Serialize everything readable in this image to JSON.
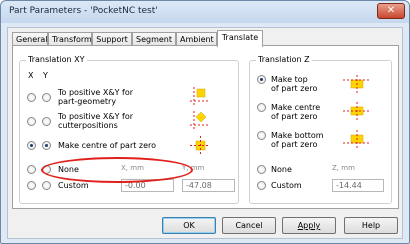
{
  "window": {
    "title": "Part Parameters - 'PocketNC test'",
    "close_glyph": "✕"
  },
  "tabs": [
    {
      "label": "General",
      "active": false
    },
    {
      "label": "Transform",
      "active": false
    },
    {
      "label": "Support",
      "active": false
    },
    {
      "label": "Segment",
      "active": false
    },
    {
      "label": "Ambient",
      "active": false
    },
    {
      "label": "Translate",
      "active": true
    }
  ],
  "translation_xy": {
    "title": "Translation XY",
    "col_x": "X",
    "col_y": "Y",
    "options": [
      {
        "label_line1": "To positive X&Y for",
        "label_line2": "part-geometry",
        "x_checked": false,
        "y_checked": false
      },
      {
        "label_line1": "To positive X&Y for",
        "label_line2": "cutterpositions",
        "x_checked": false,
        "y_checked": false
      },
      {
        "label_line1": "Make centre of part zero",
        "label_line2": "",
        "x_checked": true,
        "y_checked": true
      },
      {
        "label_line1": "None",
        "label_line2": "",
        "x_checked": false,
        "y_checked": false
      },
      {
        "label_line1": "Custom",
        "label_line2": "",
        "x_checked": false,
        "y_checked": false
      }
    ],
    "x_field_label": "X, mm",
    "y_field_label": "Y, mm",
    "x_value": "-0.00",
    "y_value": "-47.08"
  },
  "translation_z": {
    "title": "Translation Z",
    "options": [
      {
        "label_line1": "Make top",
        "label_line2": "of part zero",
        "checked": true
      },
      {
        "label_line1": "Make centre",
        "label_line2": "of part zero",
        "checked": false
      },
      {
        "label_line1": "Make bottom",
        "label_line2": "of part zero",
        "checked": false
      },
      {
        "label_line1": "None",
        "label_line2": "",
        "checked": false
      },
      {
        "label_line1": "Custom",
        "label_line2": "",
        "checked": false
      }
    ],
    "z_field_label": "Z, mm",
    "z_value": "-14.44"
  },
  "buttons": {
    "ok": "OK",
    "cancel": "Cancel",
    "apply": "Apply",
    "help": "Help"
  },
  "colors": {
    "accent_yellow": "#ffd400",
    "marker_red": "#e0201c"
  }
}
